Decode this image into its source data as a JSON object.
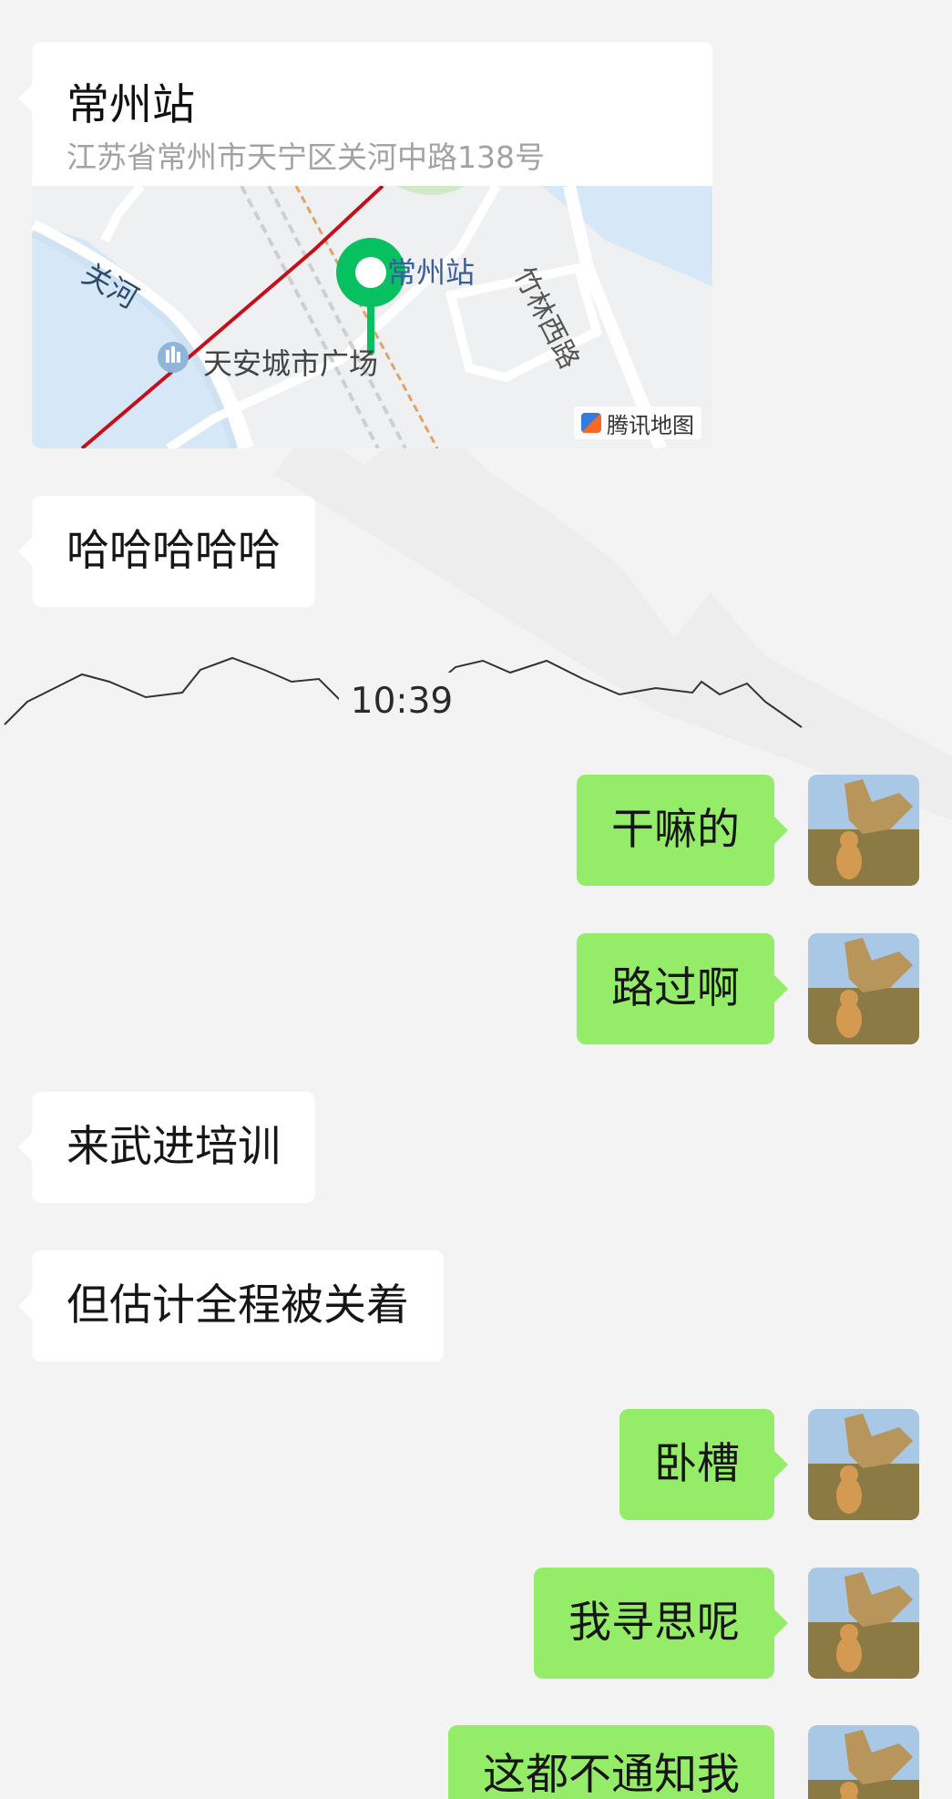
{
  "location_card": {
    "title": "常州站",
    "address": "江苏省常州市天宁区关河中路138号",
    "map": {
      "label_river": "关河",
      "label_station": "常州站",
      "label_road": "竹林西路",
      "label_plaza": "天安城市广场",
      "brand": "腾讯地图"
    }
  },
  "messages_before_time": [
    {
      "side": "in",
      "text": "哈哈哈哈哈"
    }
  ],
  "timestamp": "10:39",
  "messages": [
    {
      "side": "out",
      "text": "干嘛的"
    },
    {
      "side": "out",
      "text": "路过啊"
    },
    {
      "side": "in",
      "text": "来武进培训"
    },
    {
      "side": "in",
      "text": "但估计全程被关着"
    },
    {
      "side": "out",
      "text": "卧槽"
    },
    {
      "side": "out",
      "text": "我寻思呢"
    },
    {
      "side": "out",
      "text": "这都不通知我"
    }
  ],
  "colors": {
    "background": "#f3f3f3",
    "incoming_bubble": "#ffffff",
    "outgoing_bubble": "#95ec69",
    "map_pin": "#07c160",
    "rail_line": "#c4101b"
  }
}
